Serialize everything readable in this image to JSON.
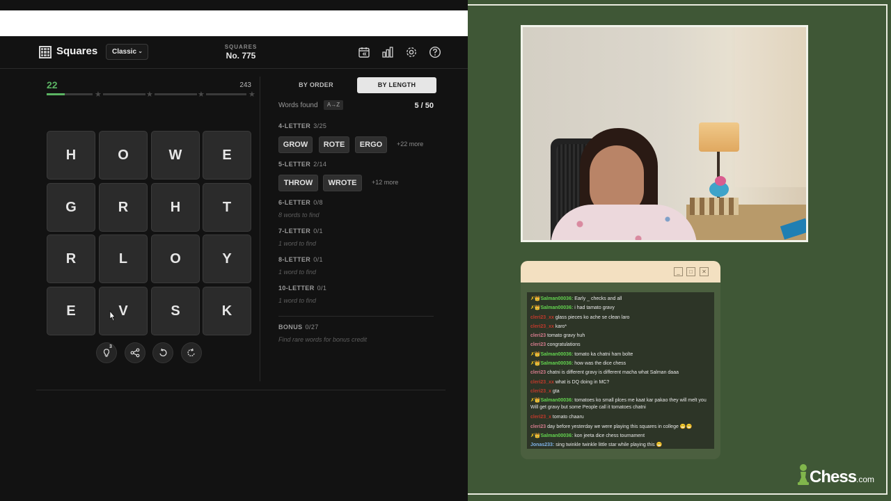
{
  "header": {
    "title": "Squares",
    "mode": "Classic",
    "puzzle_kicker": "SQUARES",
    "puzzle_number": "No. 775"
  },
  "toolbar_icons": [
    "calendar-icon",
    "stats-icon",
    "gear-icon",
    "help-icon"
  ],
  "progress": {
    "score": "22",
    "max": "243",
    "fraction": 0.09
  },
  "grid": [
    [
      "H",
      "O",
      "W",
      "E"
    ],
    [
      "G",
      "R",
      "H",
      "T"
    ],
    [
      "R",
      "L",
      "O",
      "Y"
    ],
    [
      "E",
      "V",
      "S",
      "K"
    ]
  ],
  "actions": {
    "hint_count": "3"
  },
  "tabs": {
    "by_order": "BY ORDER",
    "by_length": "BY LENGTH"
  },
  "words_found": {
    "label": "Words found",
    "sort_chip": "A→Z",
    "count": "5 / 50"
  },
  "sections": {
    "four": {
      "title": "4-LETTER",
      "count": "3/25",
      "words": [
        "GROW",
        "ROTE",
        "ERGO"
      ],
      "more": "+22 more"
    },
    "five": {
      "title": "5-LETTER",
      "count": "2/14",
      "words": [
        "THROW",
        "WROTE"
      ],
      "more": "+12 more"
    },
    "six": {
      "title": "6-LETTER",
      "count": "0/8",
      "hint": "8 words to find"
    },
    "seven": {
      "title": "7-LETTER",
      "count": "0/1",
      "hint": "1 word to find"
    },
    "eight": {
      "title": "8-LETTER",
      "count": "0/1",
      "hint": "1 word to find"
    },
    "ten": {
      "title": "10-LETTER",
      "count": "0/1",
      "hint": "1 word to find"
    },
    "bonus": {
      "title": "BONUS",
      "count": "0/27",
      "hint": "Find rare words for bonus credit"
    }
  },
  "chat": {
    "window_buttons": [
      "_",
      "□",
      "✕"
    ],
    "messages": [
      {
        "badge": "✗👑",
        "user": "Salman00036:",
        "color": "#63d44f",
        "text": " Early _ checks and all"
      },
      {
        "badge": "✗👑",
        "user": "Salman00036:",
        "color": "#63d44f",
        "text": " i had tamato gravy"
      },
      {
        "badge": "",
        "user": "cleri23_xx",
        "color": "#c0392b",
        "text": " glass pieces ko ache se clean laro"
      },
      {
        "badge": "",
        "user": "cleri23_xx",
        "color": "#c0392b",
        "text": " karo*"
      },
      {
        "badge": "",
        "user": "cleri23",
        "color": "#d47a8c",
        "text": " tomato gravy huh"
      },
      {
        "badge": "",
        "user": "cleri23",
        "color": "#d47a8c",
        "text": " congratulations"
      },
      {
        "badge": "✗👑",
        "user": "Salman00036:",
        "color": "#63d44f",
        "text": " tomato ka chatni ham bolte"
      },
      {
        "badge": "✗👑",
        "user": "Salman00036:",
        "color": "#63d44f",
        "text": " how was the dice chess"
      },
      {
        "badge": "",
        "user": "cleri23",
        "color": "#d47a8c",
        "text": " chatni is different gravy is different macha what Salman daaa"
      },
      {
        "badge": "",
        "user": "cleri23_xx",
        "color": "#c0392b",
        "text": " what is DQ doing in MC?"
      },
      {
        "badge": "",
        "user": "cleri23_x",
        "color": "#c0392b",
        "text": " gta"
      },
      {
        "badge": "✗👑",
        "user": "Salman00036:",
        "color": "#63d44f",
        "text": " tomatoes ko small plces me kaat kar pakao they will melt you Will get gravy but some People call it tomatoes chatni",
        "wrap": true
      },
      {
        "badge": "",
        "user": "cleri23_x",
        "color": "#c0392b",
        "text": " tomato chaaru"
      },
      {
        "badge": "",
        "user": "cleri23",
        "color": "#d47a8c",
        "text": " day before yesterday we were playing this squares in college 😁😁"
      },
      {
        "badge": "✗👑",
        "user": "Salman00036:",
        "color": "#63d44f",
        "text": " kon jeeta dice chess tournament"
      },
      {
        "badge": "",
        "user": "Jonas233:",
        "color": "#7fb3e8",
        "text": " sing twinkle twinkle little star while playing this 😁"
      }
    ]
  },
  "logo": {
    "name": "Chess",
    "suffix": ".com"
  }
}
